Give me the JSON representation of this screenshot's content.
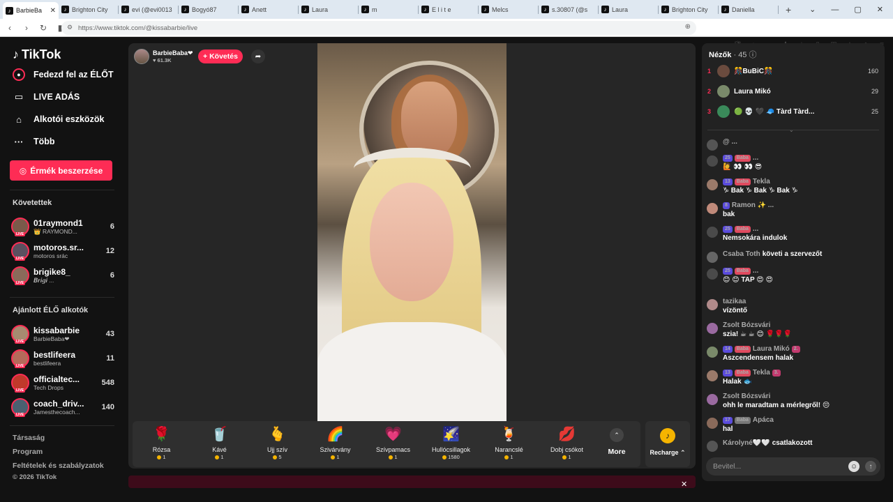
{
  "browser": {
    "tabs": [
      {
        "title": "BarbieBa",
        "active": true
      },
      {
        "title": "Brighton City"
      },
      {
        "title": "evi (@evi0013"
      },
      {
        "title": "Bogyó87"
      },
      {
        "title": "Anett"
      },
      {
        "title": "Laura"
      },
      {
        "title": "m"
      },
      {
        "title": "E l i t e"
      },
      {
        "title": "Melcs"
      },
      {
        "title": "s.30807 (@s"
      },
      {
        "title": "Laura"
      },
      {
        "title": "Brighton City"
      },
      {
        "title": "Daniella"
      }
    ],
    "new_tab": "+",
    "url": "https://www.tiktok.com/@kissabarbie/live"
  },
  "sidebar": {
    "logo": "TikTok",
    "nav": [
      {
        "label": "Fedezd fel az ÉLŐT",
        "icon": "explore-live-icon"
      },
      {
        "label": "LIVE ADÁS",
        "icon": "video-camera-icon"
      },
      {
        "label": "Alkotói eszközök",
        "icon": "creator-tools-icon"
      },
      {
        "label": "Több",
        "icon": "more-dots-icon"
      }
    ],
    "coin_button": "Érmék beszerzése",
    "following_title": "Követettek",
    "following": [
      {
        "name": "01raymond1",
        "sub": "👑 RAYMOND...",
        "count": "6"
      },
      {
        "name": "motoros.sr...",
        "sub": "motoros srác",
        "count": "12"
      },
      {
        "name": "brigike8_",
        "sub": "𝑩𝒓𝒊𝒈𝒊 ...",
        "count": "6"
      }
    ],
    "suggested_title": "Ajánlott ÉLŐ alkotók",
    "suggested": [
      {
        "name": "kissabarbie",
        "sub": "BarbieBaba❤",
        "count": "43"
      },
      {
        "name": "bestlifeera",
        "sub": "bestlifeera",
        "count": "11"
      },
      {
        "name": "officialtec...",
        "sub": "Tech Drops",
        "count": "548"
      },
      {
        "name": "coach_driv...",
        "sub": "Jamesthecoach...",
        "count": "140"
      }
    ],
    "footer": [
      "Társaság",
      "Program",
      "Feltételek és szabályzatok",
      "© 2026 TikTok"
    ]
  },
  "stream": {
    "host_name": "BarbieBaba❤",
    "host_likes": "♥ 61.3K",
    "follow_label": "+ Követés"
  },
  "gifts": [
    {
      "icon": "🌹",
      "name": "Rózsa",
      "price": "1"
    },
    {
      "icon": "🥤",
      "name": "Kávé",
      "price": "1"
    },
    {
      "icon": "🫰",
      "name": "Ujj szív",
      "price": "5"
    },
    {
      "icon": "🌈",
      "name": "Szivárvány",
      "price": "1"
    },
    {
      "icon": "💗",
      "name": "Szívpamacs",
      "price": "1"
    },
    {
      "icon": "🌠",
      "name": "Hullócsillagok",
      "price": "1580"
    },
    {
      "icon": "🍹",
      "name": "Narancslé",
      "price": "1"
    },
    {
      "icon": "💋",
      "name": "Dobj csókot",
      "price": "1"
    }
  ],
  "more_label": "More",
  "recharge_label": "Recharge",
  "chat": {
    "viewers_label": "Nézők",
    "viewers_count": "· 45",
    "top": [
      {
        "rank": "1",
        "name": "🎊BuBiC🎊",
        "score": "160"
      },
      {
        "rank": "2",
        "name": "Laura Mikó",
        "score": "29"
      },
      {
        "rank": "3",
        "name": "🟢 💀 🖤 🧢 Tàrd Tàrd...",
        "score": "25"
      }
    ],
    "messages": [
      {
        "user": "@ ...",
        "msg": ""
      },
      {
        "lvl": "25",
        "fan": "Baba",
        "user": "...",
        "msg": "🙋 👀 👀 😎"
      },
      {
        "lvl": "13",
        "fan": "Baba",
        "user": "Tekla",
        "msg": "♑ Bak ♑ Bak ♑ Bak ♑"
      },
      {
        "lvl": "8",
        "user": "Ramon ✨ ...",
        "msg": "bak"
      },
      {
        "lvl": "25",
        "fan": "Baba",
        "user": "...",
        "msg": "Nemsokára indulok"
      },
      {
        "user": "Csaba Toth",
        "msg": "követi a szervezőt",
        "system": true
      },
      {
        "lvl": "25",
        "fan": "Baba",
        "user": "...",
        "msg": "😊 😊 TAP 😍 😍"
      },
      {
        "user": "tazikaa",
        "msg": "vízöntő"
      },
      {
        "user": "Zsolt Bózsvári",
        "msg": "szia! ☕ ☕ 😊 🌹🌹🌹"
      },
      {
        "lvl": "14",
        "fan": "Baba",
        "user": "Laura Mikó",
        "rank": "2.",
        "msg": "Aszcendensem halak"
      },
      {
        "lvl": "13",
        "fan": "Baba",
        "user": "Tekla",
        "rank": "3.",
        "msg": "Halak 🐟"
      },
      {
        "user": "Zsolt Bózsvári",
        "msg": "ohh le maradtam a mérlegről! 😔"
      },
      {
        "lvl": "17",
        "fan": "Baba",
        "user": "Apáca",
        "msg": "hal"
      },
      {
        "user": "Károlyné🤍🤍",
        "msg": "csatlakozott",
        "system": true
      }
    ],
    "input_placeholder": "Bevitel..."
  }
}
